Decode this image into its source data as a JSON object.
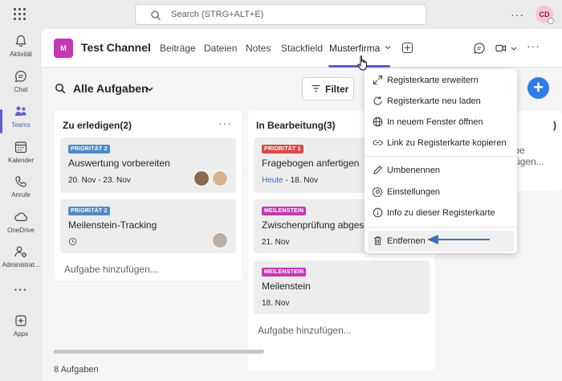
{
  "search": {
    "placeholder": "Search (STRG+ALT+E)"
  },
  "user": {
    "initials": "CD"
  },
  "rail": [
    {
      "label": "Aktivität",
      "icon": "bell-icon"
    },
    {
      "label": "Chat",
      "icon": "chat-icon"
    },
    {
      "label": "Teams",
      "icon": "teams-icon",
      "active": true
    },
    {
      "label": "Kalender",
      "icon": "calendar-icon"
    },
    {
      "label": "Anrufe",
      "icon": "phone-icon"
    },
    {
      "label": "OneDrive",
      "icon": "cloud-icon"
    },
    {
      "label": "Administrat...",
      "icon": "admin-icon"
    },
    {
      "label": "...",
      "icon": "more-icon"
    },
    {
      "label": "Apps",
      "icon": "apps-icon"
    }
  ],
  "channel": {
    "icon_letter": "M",
    "title": "Test Channel",
    "tabs": [
      "Beiträge",
      "Dateien",
      "Notes",
      "Stackfield",
      "Musterfirma"
    ]
  },
  "toolbar": {
    "view_label": "Alle Aufgaben",
    "filter_label": "Filter",
    "add_label": "+"
  },
  "columns": [
    {
      "title": "Zu erledigen(2)",
      "cards": [
        {
          "badge": "PRIORITÄT 2",
          "title": "Auswertung vorbereiten",
          "date": "20. Nov - 23. Nov"
        },
        {
          "badge": "PRIORITÄT 2",
          "title": "Meilenstein-Tracking"
        }
      ],
      "add_task": "Aufgabe hinzufügen..."
    },
    {
      "title": "In Bearbeitung(3)",
      "cards": [
        {
          "badge": "PRIORITÄT 1",
          "title": "Fragebogen anfertigen",
          "date_today": "Heute",
          "date_rest": " - 18. Nov"
        },
        {
          "badge": "MEILENSTEIN",
          "title": "Zwischenprüfung abgeschlossen",
          "date": "21. Nov"
        },
        {
          "badge": "MEILENSTEIN",
          "title": "Meilenstein",
          "date": "18. Nov"
        }
      ],
      "add_task": "Aufgabe hinzufügen..."
    },
    {
      "title": ")",
      "add_task": "Aufgabe hinzufügen..."
    }
  ],
  "menu": {
    "items": [
      {
        "label": "Registerkarte erweitern",
        "icon": "expand-icon"
      },
      {
        "label": "Registerkarte neu laden",
        "icon": "refresh-icon"
      },
      {
        "label": "In neuem Fenster öffnen",
        "icon": "globe-icon"
      },
      {
        "label": "Link zu Registerkarte kopieren",
        "icon": "link-icon"
      },
      {
        "label": "Umbenennen",
        "icon": "pencil-icon"
      },
      {
        "label": "Einstellungen",
        "icon": "settings-icon"
      },
      {
        "label": "Info zu dieser Registerkarte",
        "icon": "info-icon"
      },
      {
        "label": "Entfernen",
        "icon": "trash-icon"
      }
    ]
  },
  "footer": {
    "count": "8 Aufgaben"
  },
  "colors": {
    "accent": "#5b5fc7",
    "channel": "#c239b3",
    "badge_blue": "#4f88c6",
    "badge_red": "#d94a4a",
    "badge_purple": "#c239b3",
    "arrow": "#3d6fb5"
  }
}
